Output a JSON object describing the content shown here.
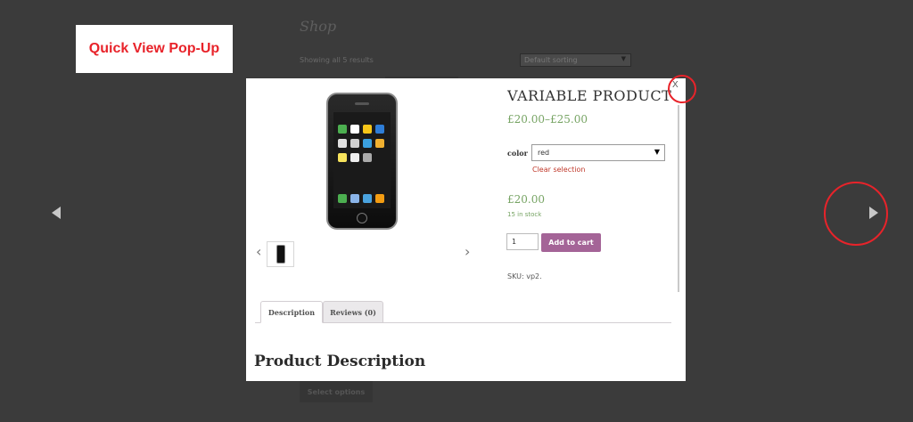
{
  "background_page": {
    "title": "Shop",
    "results": "Showing all 5 results",
    "sorting": "Default sorting",
    "select_options": "Select options"
  },
  "annotation": {
    "label": "Quick View Pop-Up",
    "color": "#e8232a"
  },
  "modal": {
    "close_label": "X",
    "product": {
      "title": "VARIABLE PRODUCT",
      "price_range": "£20.00–£25.00",
      "attribute_label": "color",
      "attribute_value": "red",
      "clear_selection": "Clear selection",
      "variation_price": "£20.00",
      "stock": "15 in stock",
      "quantity": "1",
      "add_to_cart": "Add to cart",
      "sku": "SKU: vp2."
    },
    "gallery": {
      "prev_icon": "chevron-left-icon",
      "next_icon": "chevron-right-icon"
    },
    "tabs": [
      {
        "label": "Description",
        "active": true
      },
      {
        "label": "Reviews (0)",
        "active": false
      }
    ],
    "description_heading": "Product Description"
  },
  "navigation": {
    "prev_icon": "triangle-left-icon",
    "next_icon": "triangle-right-icon"
  },
  "colors": {
    "price_green": "#77a464",
    "button_purple": "#a46497",
    "overlay": "#3b3b3b"
  }
}
